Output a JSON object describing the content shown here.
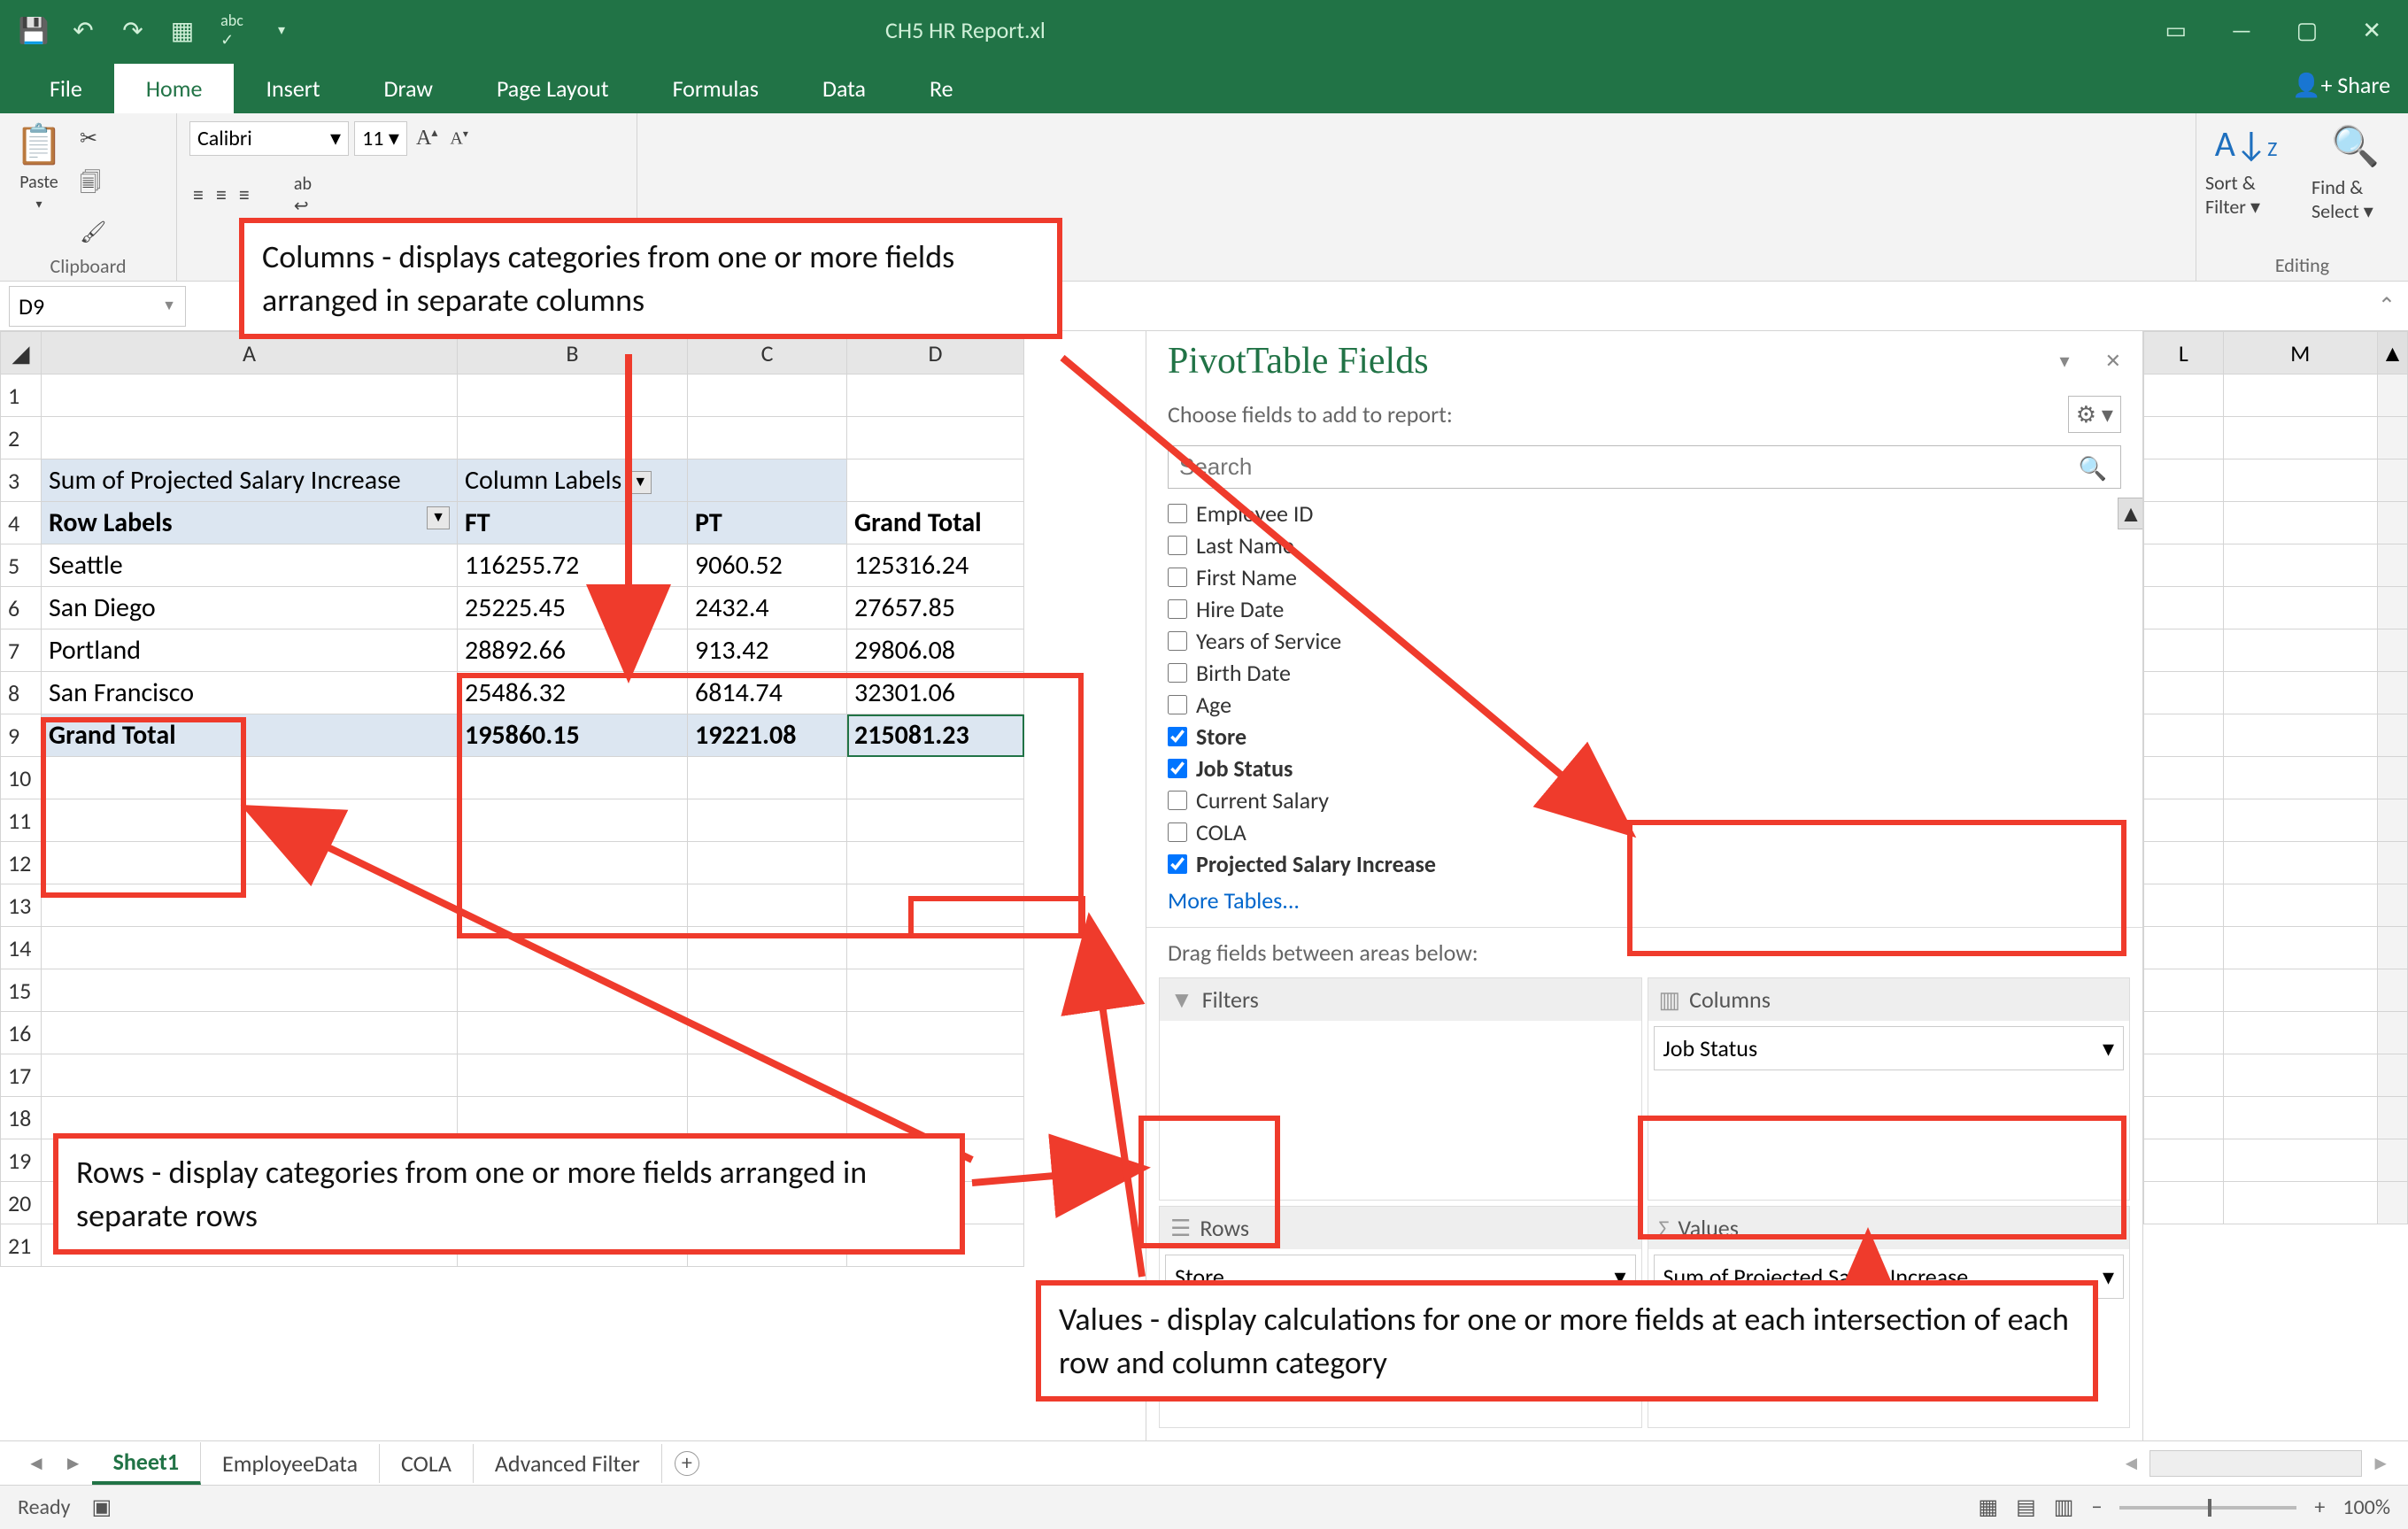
{
  "app": {
    "filename": "CH5 HR Report.xl"
  },
  "ribbon": {
    "tabs": [
      "File",
      "Home",
      "Insert",
      "Draw",
      "Page Layout",
      "Formulas",
      "Data",
      "Re"
    ],
    "active_tab": "Home",
    "share": "Share",
    "clipboard_label": "Clipboard",
    "paste": "Paste",
    "font_name": "Calibri",
    "font_size": "11",
    "editing_label": "Editing",
    "sort_filter": "Sort & Filter",
    "find_select": "Find & Select"
  },
  "formula": {
    "name_box": "D9"
  },
  "pivot_table": {
    "a3": "Sum of Projected Salary Increase",
    "b3": "Column Labels",
    "a4": "Row Labels",
    "b4": "FT",
    "c4": "PT",
    "d4": "Grand Total",
    "rows": [
      {
        "label": "Seattle",
        "ft": "116255.72",
        "pt": "9060.52",
        "gt": "125316.24"
      },
      {
        "label": "San Diego",
        "ft": "25225.45",
        "pt": "2432.4",
        "gt": "27657.85"
      },
      {
        "label": "Portland",
        "ft": "28892.66",
        "pt": "913.42",
        "gt": "29806.08"
      },
      {
        "label": "San Francisco",
        "ft": "25486.32",
        "pt": "6814.74",
        "gt": "32301.06"
      }
    ],
    "a9": "Grand Total",
    "b9": "195860.15",
    "c9": "19221.08",
    "d9": "215081.23"
  },
  "right_cols": [
    "L",
    "M"
  ],
  "ptf": {
    "title": "PivotTable Fields",
    "sub": "Choose fields to add to report:",
    "search_placeholder": "Search",
    "fields": [
      {
        "label": "Employee ID",
        "checked": false
      },
      {
        "label": "Last Name",
        "checked": false
      },
      {
        "label": "First Name",
        "checked": false
      },
      {
        "label": "Hire Date",
        "checked": false
      },
      {
        "label": "Years of Service",
        "checked": false
      },
      {
        "label": "Birth Date",
        "checked": false
      },
      {
        "label": "Age",
        "checked": false
      },
      {
        "label": "Store",
        "checked": true
      },
      {
        "label": "Job Status",
        "checked": true
      },
      {
        "label": "Current Salary",
        "checked": false
      },
      {
        "label": "COLA",
        "checked": false
      },
      {
        "label": "Projected Salary Increase",
        "checked": true
      }
    ],
    "more": "More Tables...",
    "drag_label": "Drag fields between areas below:",
    "areas": {
      "filters": "Filters",
      "columns": "Columns",
      "rows": "Rows",
      "values": "Values",
      "columns_field": "Job Status",
      "rows_field": "Store",
      "values_field": "Sum of Projected Salary Increase"
    }
  },
  "sheet_tabs": [
    "Sheet1",
    "EmployeeData",
    "COLA",
    "Advanced Filter"
  ],
  "sheet_active": "Sheet1",
  "status": {
    "ready": "Ready",
    "zoom": "100%"
  },
  "callouts": {
    "cols": "Columns - displays categories from one or more fields arranged in separate columns",
    "rows": "Rows - display categories from one or more fields arranged in separate rows",
    "vals": "Values - display calculations for one or more fields at each intersection of each row and column category"
  }
}
